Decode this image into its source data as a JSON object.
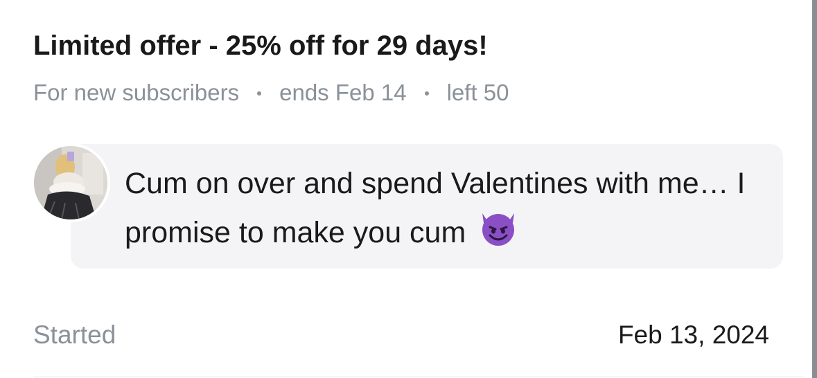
{
  "offer": {
    "title": "Limited offer - 25% off for 29 days!",
    "audience": "For new subscribers",
    "ends": "ends Feb 14",
    "left": "left 50"
  },
  "message": {
    "text": "Cum on over and spend Valentines with me… I promise to make you cum",
    "emoji": "smiling-face-with-horns-icon"
  },
  "footer": {
    "started_label": "Started",
    "started_date": "Feb 13, 2024"
  },
  "colors": {
    "title_text": "#1a1a1a",
    "muted_text": "#8a9199",
    "bubble_bg": "#f4f4f7",
    "emoji_purple": "#8a4fc4",
    "scroll_border": "#8a8d92"
  }
}
